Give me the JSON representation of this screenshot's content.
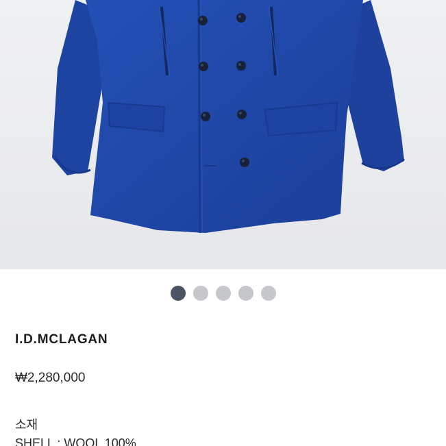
{
  "product": {
    "brand": "I.D.MCLAGAN",
    "price": "₩2,280,000",
    "material_heading": "소재",
    "material_line": "SHELL : WOOL 100%"
  },
  "image": {
    "subject": "blue-wool-double-breasted-pea-coat",
    "coat_color": "#1f47a7"
  },
  "carousel": {
    "count": 5,
    "active_index": 0,
    "active_color": "#4c5363",
    "inactive_color": "#c6c7cb"
  }
}
